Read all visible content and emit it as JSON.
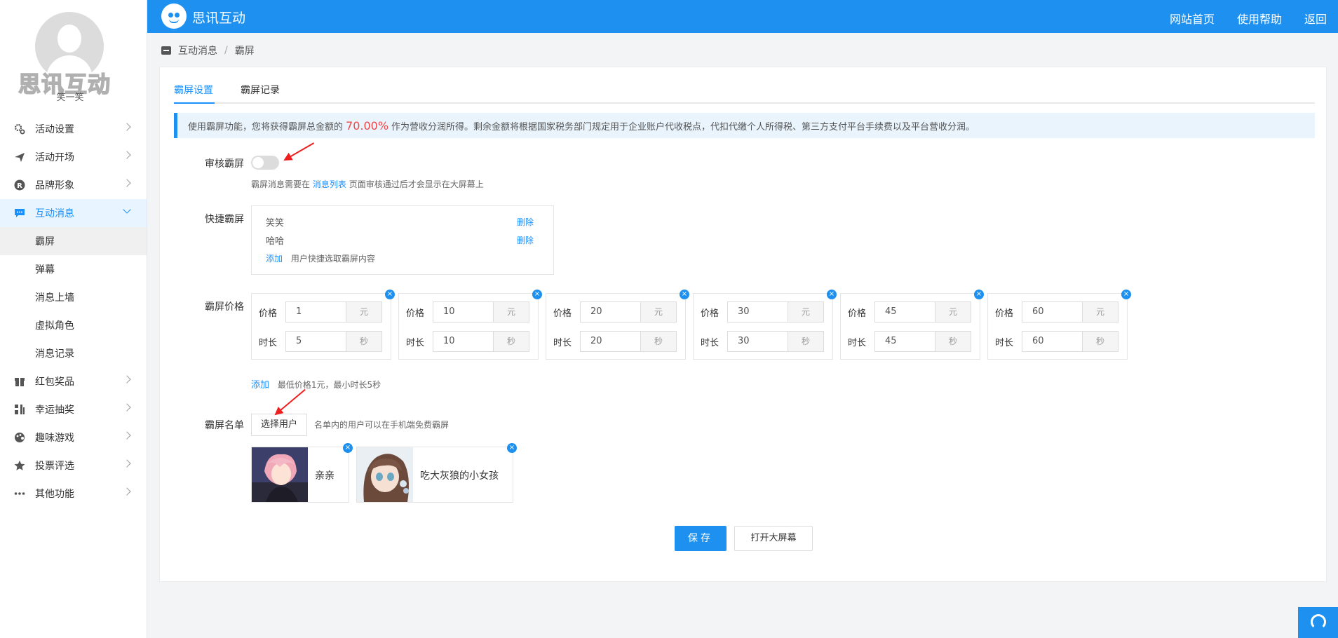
{
  "app": {
    "brand": "思讯互动"
  },
  "top_nav": [
    "网站首页",
    "使用帮助",
    "返回"
  ],
  "profile": {
    "watermark": "思讯互动",
    "username": "笑一笑"
  },
  "sidebar": {
    "items": [
      {
        "label": "活动设置",
        "icon": "gear-icon"
      },
      {
        "label": "活动开场",
        "icon": "paper-plane-icon"
      },
      {
        "label": "品牌形象",
        "icon": "registered-icon"
      },
      {
        "label": "互动消息",
        "icon": "chat-icon"
      }
    ],
    "subitems": [
      "霸屏",
      "弹幕",
      "消息上墙",
      "虚拟角色",
      "消息记录"
    ],
    "items_after": [
      {
        "label": "红包奖品",
        "icon": "gift-icon"
      },
      {
        "label": "幸运抽奖",
        "icon": "lottery-icon"
      },
      {
        "label": "趣味游戏",
        "icon": "palette-icon"
      },
      {
        "label": "投票评选",
        "icon": "star-icon"
      },
      {
        "label": "其他功能",
        "icon": "more-icon"
      }
    ]
  },
  "breadcrumb": {
    "parent": "互动消息",
    "separator": "/",
    "current": "霸屏"
  },
  "tabs": [
    "霸屏设置",
    "霸屏记录"
  ],
  "notice": {
    "before": "使用霸屏功能，您将获得霸屏总金额的",
    "percent": "70.00%",
    "after": "作为营收分润所得。剩余金额将根据国家税务部门规定用于企业账户代收税点，代扣代缴个人所得税、第三方支付平台手续费以及平台营收分润。"
  },
  "review": {
    "label": "审核霸屏",
    "enabled": false,
    "hint_before": "霸屏消息需要在",
    "hint_link": "消息列表",
    "hint_after": "页面审核通过后才会显示在大屏幕上"
  },
  "quick": {
    "label": "快捷霸屏",
    "items": [
      "笑笑",
      "哈哈"
    ],
    "delete_label": "删除",
    "add_label": "添加",
    "add_hint": "用户快捷选取霸屏内容"
  },
  "price": {
    "label": "霸屏价格",
    "price_label": "价格",
    "duration_label": "时长",
    "price_unit": "元",
    "duration_unit": "秒",
    "close_glyph": "×",
    "tiers": [
      {
        "price": "1",
        "duration": "5"
      },
      {
        "price": "10",
        "duration": "10"
      },
      {
        "price": "20",
        "duration": "20"
      },
      {
        "price": "30",
        "duration": "30"
      },
      {
        "price": "45",
        "duration": "45"
      },
      {
        "price": "60",
        "duration": "60"
      }
    ],
    "add_label": "添加",
    "add_hint": "最低价格1元，最小时长5秒"
  },
  "whitelist": {
    "label": "霸屏名单",
    "select_button": "选择用户",
    "hint": "名单内的用户可以在手机端免费霸屏",
    "users": [
      {
        "name": "亲亲"
      },
      {
        "name": "吃大灰狼的小女孩"
      }
    ]
  },
  "actions": {
    "save": "保存",
    "open_screen": "打开大屏幕"
  },
  "colors": {
    "primary": "#1e90f0",
    "accent_red": "#f04848",
    "annotation_arrow": "#f01e1e"
  }
}
